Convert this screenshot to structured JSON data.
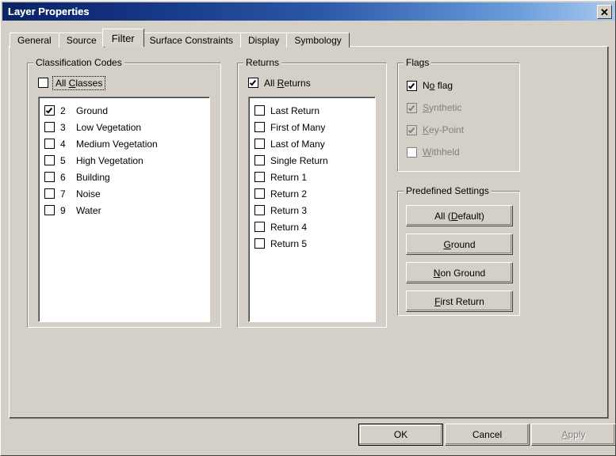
{
  "window": {
    "title": "Layer Properties",
    "close_icon": "close-icon",
    "close_glyph": "✕"
  },
  "tabs": [
    {
      "label": "General",
      "active": false
    },
    {
      "label": "Source",
      "active": false
    },
    {
      "label": "Filter",
      "active": true
    },
    {
      "label": "Surface Constraints",
      "active": false
    },
    {
      "label": "Display",
      "active": false
    },
    {
      "label": "Symbology",
      "active": false
    }
  ],
  "classification_codes": {
    "title": "Classification Codes",
    "all_classes": {
      "label_before": "All ",
      "accel": "C",
      "label_after": "lasses",
      "checked": false,
      "focused": true
    },
    "items": [
      {
        "code": "2",
        "name": "Ground",
        "checked": true
      },
      {
        "code": "3",
        "name": "Low Vegetation",
        "checked": false
      },
      {
        "code": "4",
        "name": "Medium Vegetation",
        "checked": false
      },
      {
        "code": "5",
        "name": "High Vegetation",
        "checked": false
      },
      {
        "code": "6",
        "name": "Building",
        "checked": false
      },
      {
        "code": "7",
        "name": "Noise",
        "checked": false
      },
      {
        "code": "9",
        "name": "Water",
        "checked": false
      }
    ]
  },
  "returns": {
    "title": "Returns",
    "all_returns": {
      "label_before": "All ",
      "accel": "R",
      "label_after": "eturns",
      "checked": true,
      "focused": false
    },
    "items": [
      {
        "name": "Last Return",
        "checked": false
      },
      {
        "name": "First of Many",
        "checked": false
      },
      {
        "name": "Last of Many",
        "checked": false
      },
      {
        "name": "Single Return",
        "checked": false
      },
      {
        "name": "Return 1",
        "checked": false
      },
      {
        "name": "Return 2",
        "checked": false
      },
      {
        "name": "Return 3",
        "checked": false
      },
      {
        "name": "Return 4",
        "checked": false
      },
      {
        "name": "Return 5",
        "checked": false
      }
    ]
  },
  "flags": {
    "title": "Flags",
    "items": [
      {
        "label_before": "N",
        "accel": "o",
        "label_after": " flag",
        "checked": true,
        "enabled": true
      },
      {
        "label_before": "",
        "accel": "S",
        "label_after": "ynthetic",
        "checked": true,
        "enabled": false
      },
      {
        "label_before": "",
        "accel": "K",
        "label_after": "ey-Point",
        "checked": true,
        "enabled": false
      },
      {
        "label_before": "",
        "accel": "W",
        "label_after": "ithheld",
        "checked": false,
        "enabled": false
      }
    ]
  },
  "predefined_settings": {
    "title": "Predefined Settings",
    "buttons": [
      {
        "label_before": "All (",
        "accel": "D",
        "label_after": "efault)",
        "enabled": true
      },
      {
        "label_before": "",
        "accel": "G",
        "label_after": "round",
        "enabled": true
      },
      {
        "label_before": "",
        "accel": "N",
        "label_after": "on Ground",
        "enabled": true
      },
      {
        "label_before": "",
        "accel": "F",
        "label_after": "irst Return",
        "enabled": true
      }
    ]
  },
  "dialog_buttons": [
    {
      "label_before": "OK",
      "accel": "",
      "label_after": "",
      "enabled": true,
      "default": true
    },
    {
      "label_before": "Cancel",
      "accel": "",
      "label_after": "",
      "enabled": true,
      "default": false
    },
    {
      "label_before": "",
      "accel": "A",
      "label_after": "pply",
      "enabled": false,
      "default": false
    }
  ],
  "colors": {
    "dialog_face": "#d4d0c8",
    "title_dark": "#0a2463",
    "title_light": "#a9c9ef",
    "disabled_text": "#808080",
    "window_bg": "#ffffff"
  }
}
